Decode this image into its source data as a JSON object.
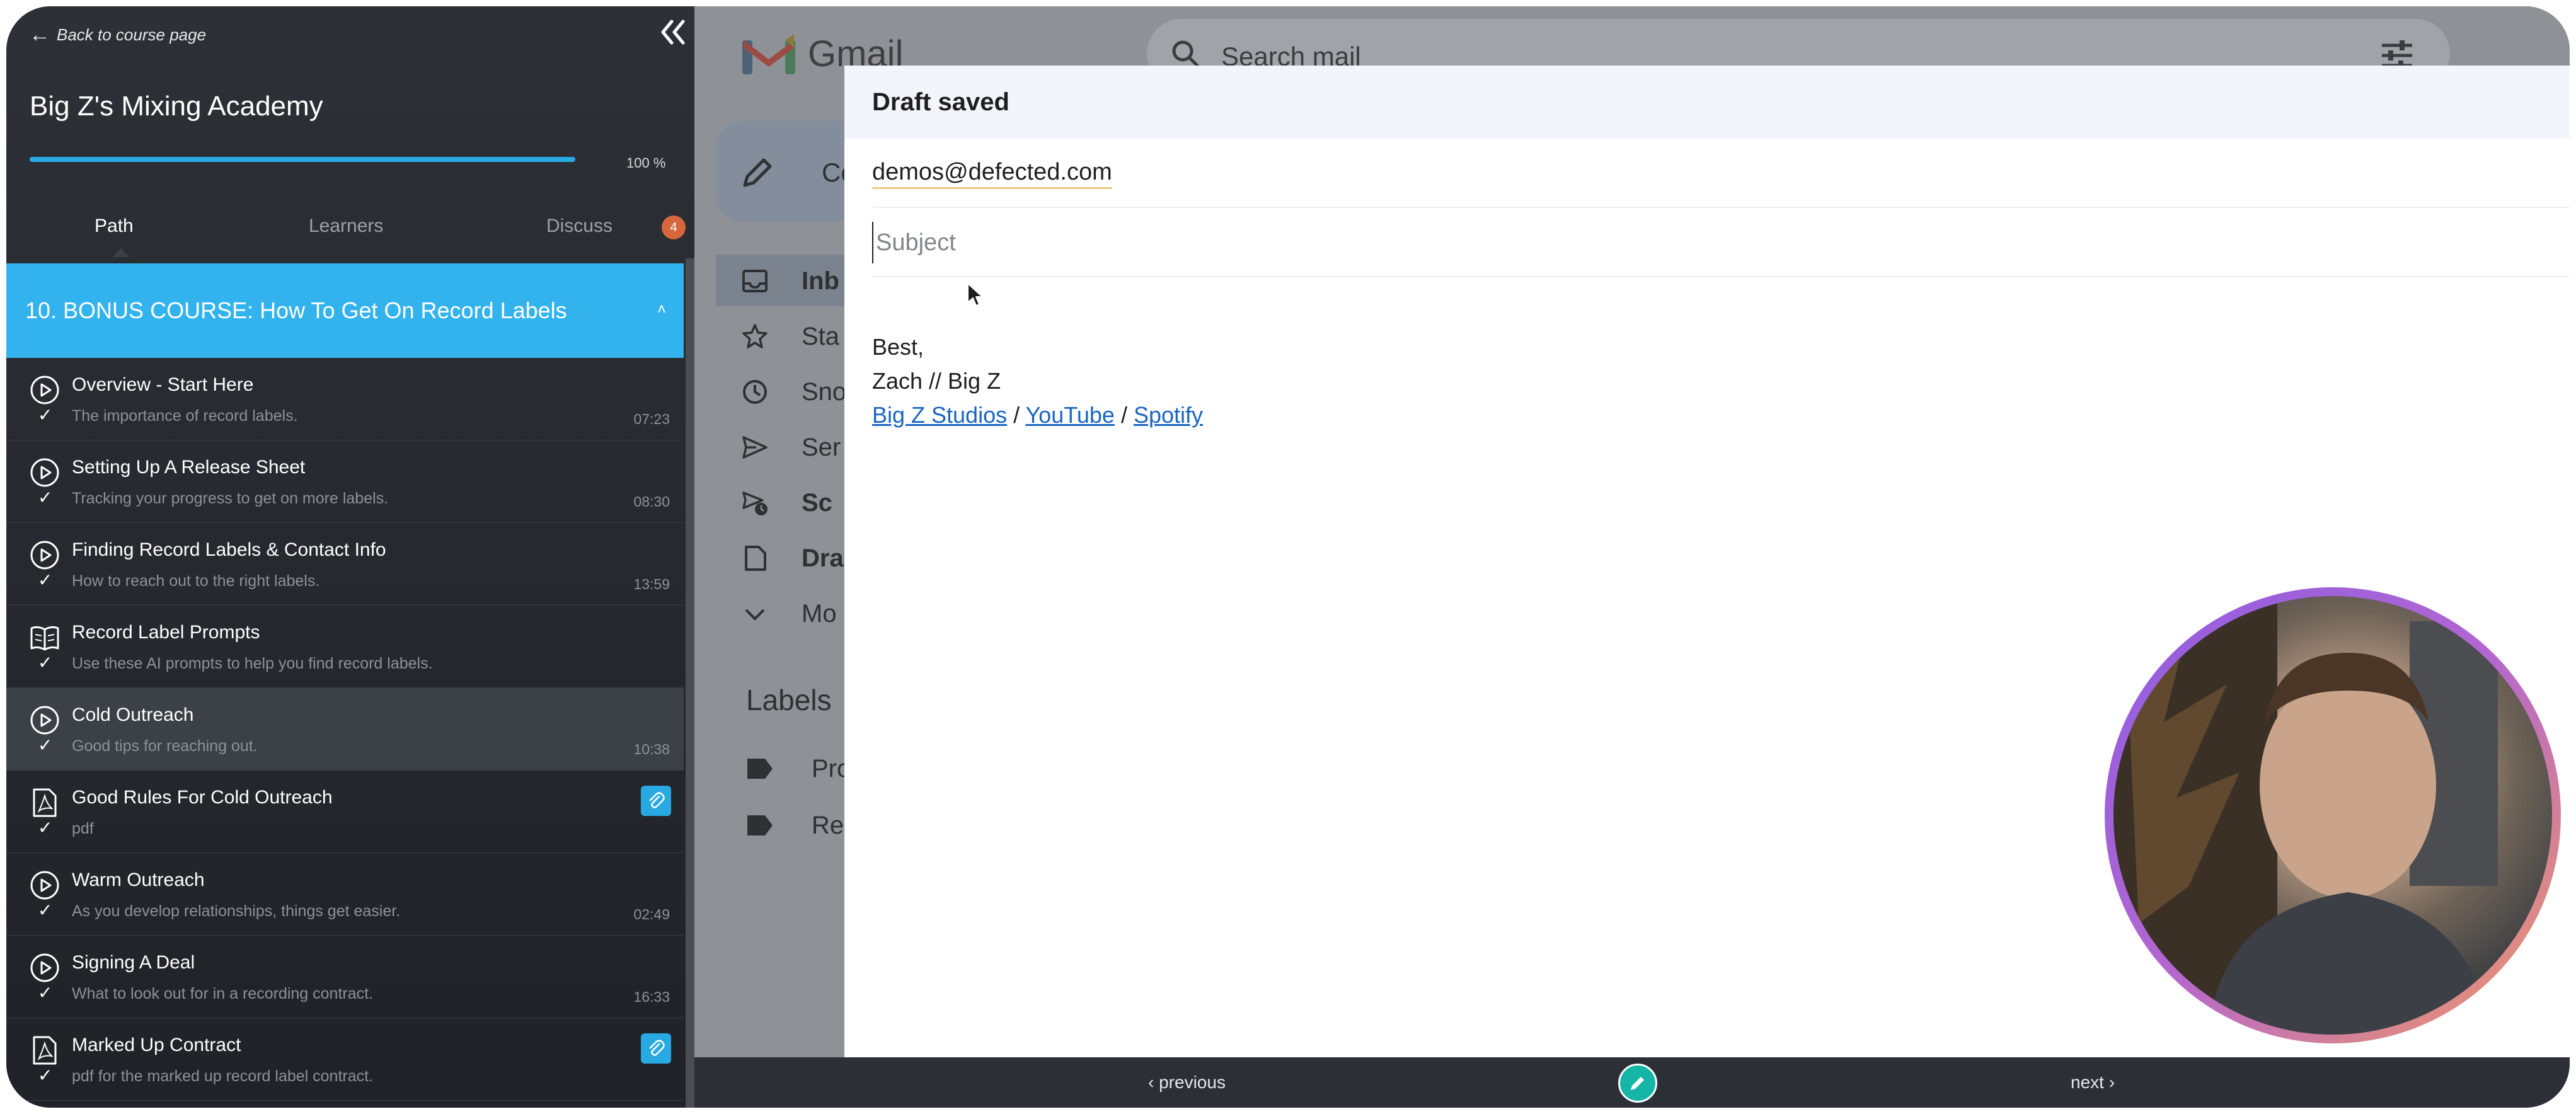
{
  "sidebar": {
    "back_label": "Back to course page",
    "course_title": "Big Z's Mixing Academy",
    "progress_percent": 100,
    "progress_label": "100 %",
    "tabs": [
      {
        "label": "Path",
        "active": true
      },
      {
        "label": "Learners",
        "active": false
      },
      {
        "label": "Discuss",
        "active": false
      }
    ],
    "discuss_badge": "4",
    "section_title": "10. BONUS COURSE: How To Get On Record Labels",
    "lessons": [
      {
        "type": "video",
        "title": "Overview - Start Here",
        "subtitle": "The importance of record labels.",
        "duration": "07:23",
        "completed": true
      },
      {
        "type": "video",
        "title": " Setting Up A Release Sheet",
        "subtitle": "Tracking your progress to get on more labels.",
        "duration": "08:30",
        "completed": true
      },
      {
        "type": "video",
        "title": "Finding Record Labels & Contact Info",
        "subtitle": "How to reach out to the right labels.",
        "duration": "13:59",
        "completed": true
      },
      {
        "type": "reading",
        "title": "Record Label Prompts",
        "subtitle": "Use these AI prompts to help you find record labels.",
        "duration": "",
        "completed": true
      },
      {
        "type": "video",
        "title": "Cold Outreach",
        "subtitle": "Good tips for reaching out.",
        "duration": "10:38",
        "completed": true,
        "current": true
      },
      {
        "type": "pdf",
        "title": "Good Rules For Cold Outreach",
        "subtitle": "pdf",
        "duration": "",
        "completed": true,
        "attachment": true
      },
      {
        "type": "video",
        "title": "Warm Outreach",
        "subtitle": "As you develop relationships, things get easier.",
        "duration": "02:49",
        "completed": true
      },
      {
        "type": "video",
        "title": "Signing A Deal",
        "subtitle": "What to look out for in a recording contract.",
        "duration": "16:33",
        "completed": true
      },
      {
        "type": "pdf",
        "title": "Marked Up Contract",
        "subtitle": "pdf for the marked up record label contract.",
        "duration": "",
        "completed": true,
        "attachment": true
      }
    ]
  },
  "gmail": {
    "brand": "Gmail",
    "search_placeholder": "Search mail",
    "compose_label": "Co",
    "nav": [
      {
        "icon": "inbox-icon",
        "label": "Inb",
        "bold": true,
        "active": true
      },
      {
        "icon": "star-icon",
        "label": "Sta",
        "bold": false
      },
      {
        "icon": "clock-icon",
        "label": "Sno",
        "bold": false
      },
      {
        "icon": "send-icon",
        "label": "Ser",
        "bold": false
      },
      {
        "icon": "scheduled-icon",
        "label": "Sc",
        "bold": true
      },
      {
        "icon": "draft-icon",
        "label": "Dra",
        "bold": true
      },
      {
        "icon": "chevron-down-icon",
        "label": "Mo",
        "bold": false
      }
    ],
    "labels_heading": "Labels",
    "labels": [
      {
        "label": "Pro"
      },
      {
        "label": "Rec"
      }
    ]
  },
  "compose": {
    "status": "Draft saved",
    "to": "demos@defected.com",
    "subject_placeholder": "Subject",
    "subject_value": "",
    "signoff": "Best,",
    "signature_name": "Zach // Big Z",
    "links": [
      "Big Z Studios",
      "YouTube",
      "Spotify"
    ],
    "separator": " / "
  },
  "player": {
    "previous_label": "‹ previous",
    "next_label": "next ›"
  },
  "colors": {
    "accent_blue": "#33b3ee",
    "badge_orange": "#d6673d",
    "edit_teal": "#15b5a8",
    "link_blue": "#1a65c2"
  }
}
